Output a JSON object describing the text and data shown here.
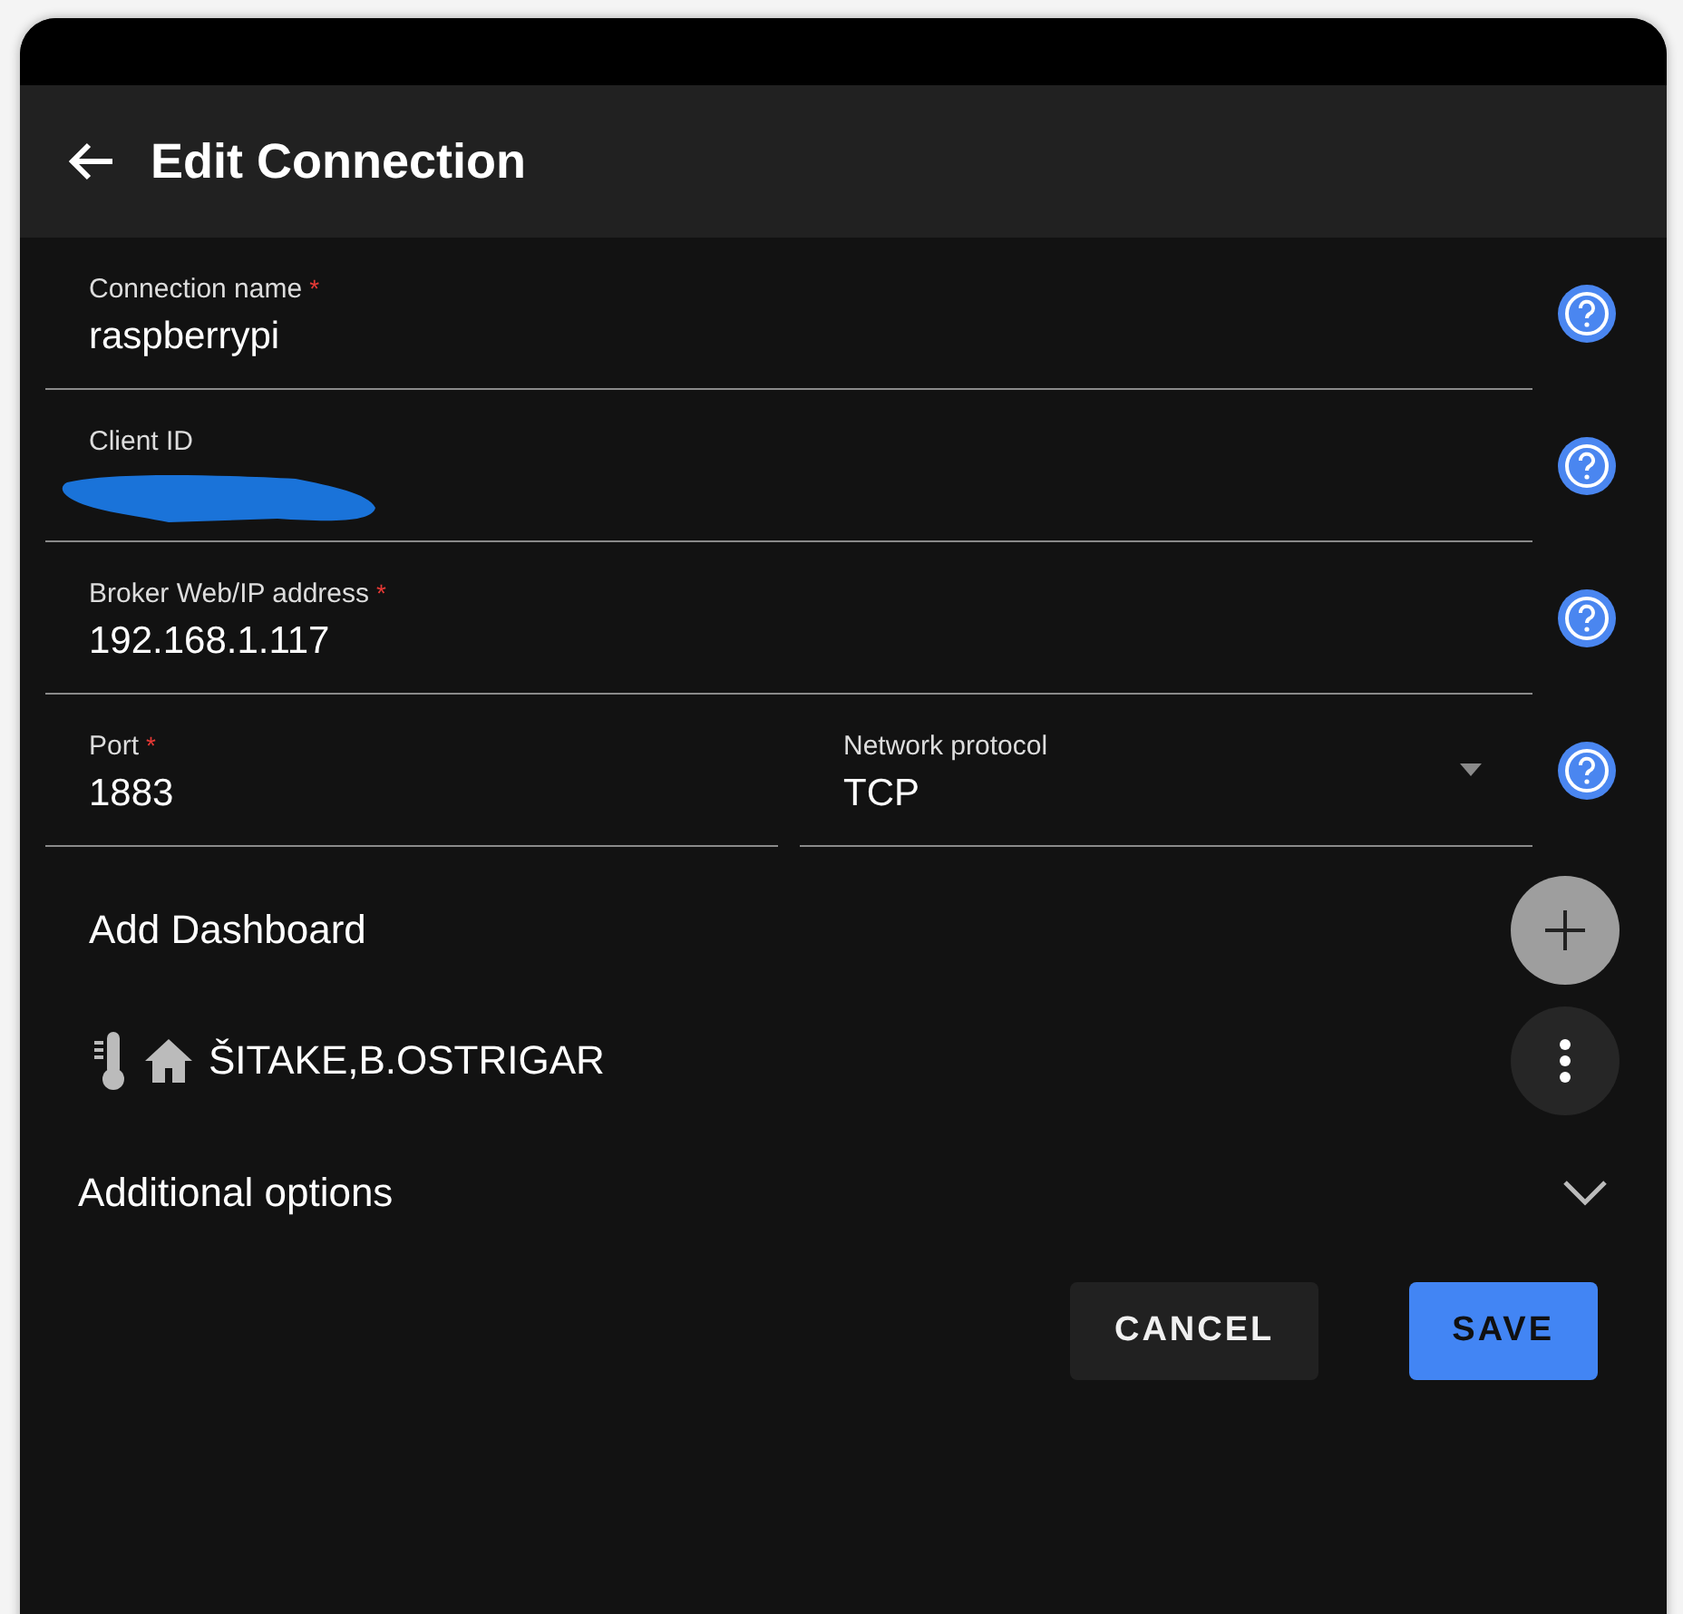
{
  "header": {
    "title": "Edit Connection"
  },
  "rows": [
    {
      "fields": [
        {
          "kind": "text",
          "label": "Connection name",
          "required_mark": "*",
          "value": "raspberrypi"
        }
      ]
    },
    {
      "fields": [
        {
          "kind": "redacted",
          "label": "Client ID"
        }
      ]
    },
    {
      "fields": [
        {
          "kind": "text",
          "label": "Broker Web/IP address",
          "required_mark": "*",
          "value": "192.168.1.117"
        }
      ]
    },
    {
      "fields": [
        {
          "kind": "text",
          "label": "Port",
          "required_mark": "*",
          "value": "1883"
        },
        {
          "kind": "select",
          "label": "Network protocol",
          "value": "TCP"
        }
      ]
    }
  ],
  "dashboards": {
    "label": "Add Dashboard",
    "items": [
      {
        "name": "ŠITAKE,B.OSTRIGAR"
      }
    ]
  },
  "additional_options": {
    "label": "Additional options",
    "expanded": false
  },
  "buttons": [
    {
      "kind": "text",
      "label": "CANCEL"
    },
    {
      "kind": "primary",
      "label": "SAVE"
    }
  ]
}
